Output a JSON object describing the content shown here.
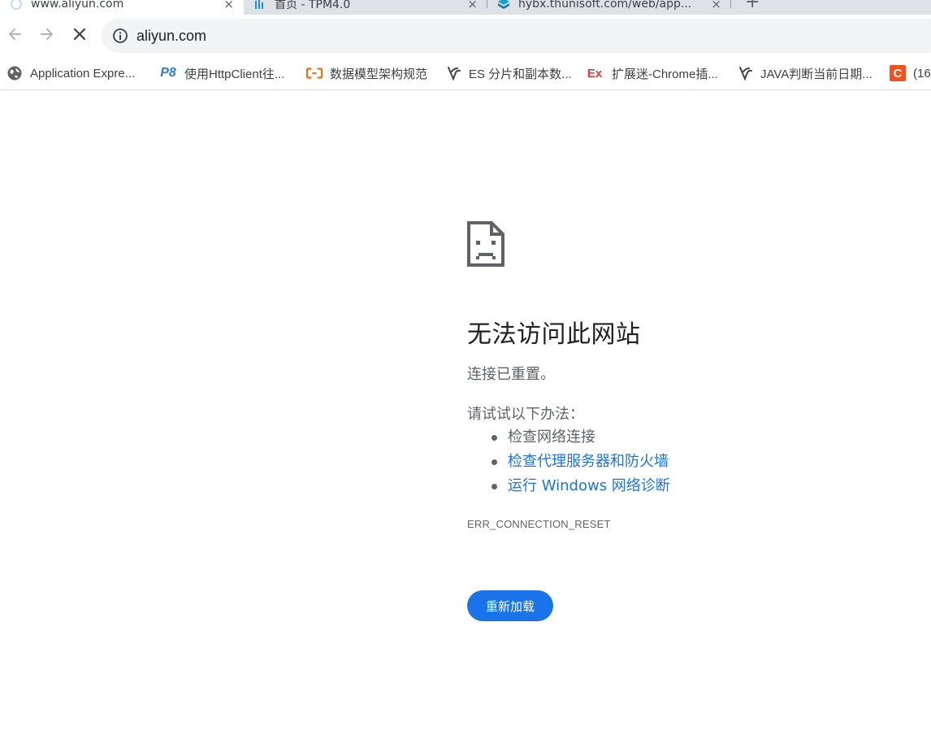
{
  "tabs": [
    {
      "title": "www.aliyun.com",
      "active": true,
      "close": "×"
    },
    {
      "title": "首页 - TPM4.0",
      "active": false,
      "close": "×"
    },
    {
      "title": "hybx.thunisoft.com/web/app...",
      "active": false,
      "close": "×"
    }
  ],
  "new_tab": "+",
  "toolbar": {
    "back_icon": "arrow-left-icon",
    "forward_icon": "arrow-right-icon",
    "stop_icon": "close-icon",
    "address": "aliyun.com",
    "site_info_icon": "info-icon"
  },
  "bookmarks": [
    {
      "label": "Application Expre...",
      "icon": "globe-icon"
    },
    {
      "label": "使用HttpClient往...",
      "icon": "p8-icon"
    },
    {
      "label": "数据模型架构规范",
      "icon": "aliyun-icon"
    },
    {
      "label": "ES 分片和副本数...",
      "icon": "dev-icon"
    },
    {
      "label": "扩展迷-Chrome插...",
      "icon": "ex-icon"
    },
    {
      "label": "JAVA判断当前日期...",
      "icon": "dev-icon"
    },
    {
      "label": "(16",
      "icon": "csdn-icon"
    }
  ],
  "bookmark_icon_text": {
    "p8": "P8",
    "ex": "Ex",
    "csdn": "C"
  },
  "error": {
    "title": "无法访问此网站",
    "message": "连接已重置。",
    "try_label": "请试试以下办法：",
    "suggestions": [
      {
        "text": "检查网络连接",
        "link": false
      },
      {
        "text": "检查代理服务器和防火墙",
        "link": true
      },
      {
        "text": "运行 Windows 网络诊断",
        "link": true
      }
    ],
    "code": "ERR_CONNECTION_RESET",
    "reload_label": "重新加载"
  },
  "colors": {
    "accent": "#1a73e8",
    "text_secondary": "#5f6368",
    "tabstrip_bg": "#dee1e6",
    "omnibox_bg": "#f1f3f4"
  }
}
